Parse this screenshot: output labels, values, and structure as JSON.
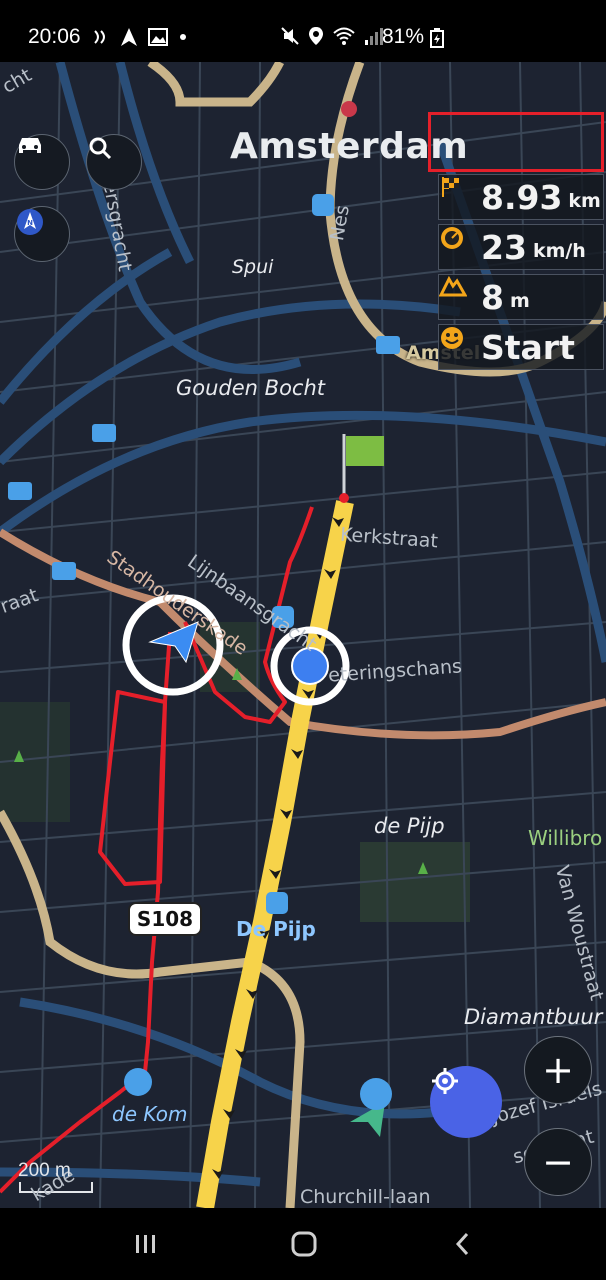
{
  "status_bar": {
    "time": "20:06",
    "battery": "81%",
    "icons": [
      "vibration-icon",
      "navigation-arrow-icon",
      "image-icon",
      "dot-icon",
      "mute-icon",
      "location-pin-icon",
      "wifi-icon",
      "signal-icon",
      "battery-charging-icon"
    ]
  },
  "map": {
    "city_label": "Amsterdam",
    "labels": {
      "spui": "Spui",
      "gouden_bocht": "Gouden Bocht",
      "kerkstraat": "Kerkstraat",
      "weteringschans": "eteringschans",
      "de_pijp_area": "de Pijp",
      "de_pijp_station": "De Pijp",
      "willibrord": "Willibro",
      "van_woustraat": "Van Woustraat",
      "diamantbuurt": "Diamantbuur",
      "jozef_israels": "Jozef Israëls",
      "de_kom": "de Kom",
      "churchill_laan": "Churchill-laan",
      "amstel": "Amstel",
      "nes": "Nes",
      "keizersgracht": "eizersgracht",
      "stadhouderskade": "Stadhouderskade",
      "lijnbaansgracht": "Lijnbaansgracht",
      "straat_left": "raat",
      "kade_bottom": "kade",
      "cht": "cht",
      "selstraat": "selstraat"
    },
    "road_shield": "S108",
    "scale_label": "200 m"
  },
  "info_panel": {
    "distance": {
      "value": "8.93",
      "unit": "km",
      "icon": "checkered-flag-icon"
    },
    "speed": {
      "value": "23",
      "unit": "km/h",
      "icon": "speedometer-icon"
    },
    "elevation": {
      "value": "8",
      "unit": "m",
      "icon": "mountain-icon"
    },
    "status": {
      "value": "Start",
      "icon": "smiley-icon"
    }
  },
  "buttons": {
    "vehicle": "car-icon",
    "search": "search-icon",
    "compass": "compass-icon",
    "zoom_in": "+",
    "zoom_out": "−",
    "locate": "my-location-icon"
  },
  "colors": {
    "route_yellow": "#f7d34a",
    "track_red": "#e51f2a",
    "water": "#2a4e78",
    "road_tan": "#c9b48a",
    "location_blue": "#3d7ff0",
    "highlight_red": "#e5202a",
    "flag_green": "#7dbd43"
  }
}
